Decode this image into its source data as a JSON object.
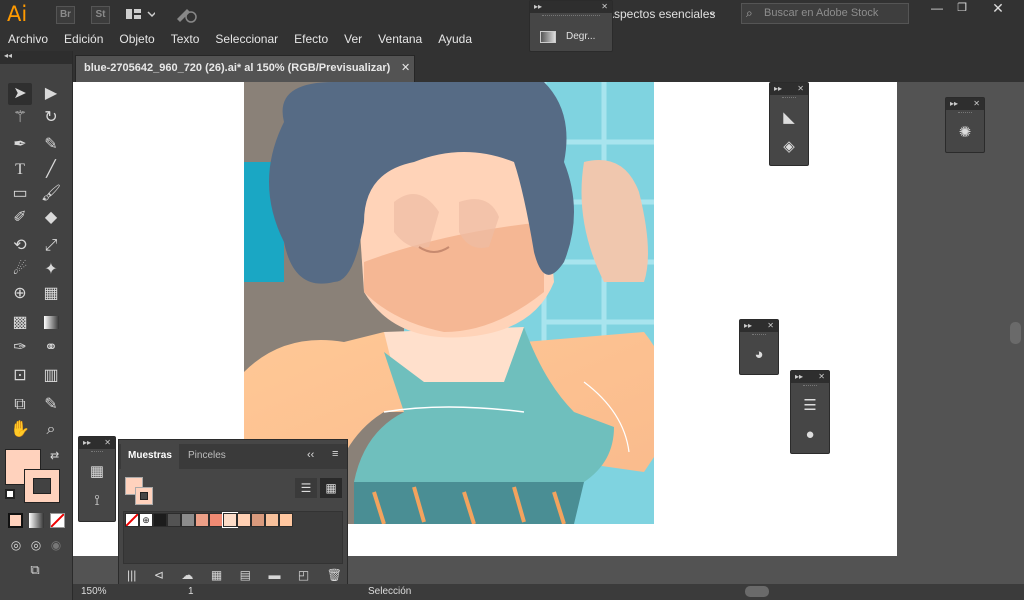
{
  "app": {
    "logo": "Ai",
    "bridge": "Br",
    "stock": "St",
    "workspace": "Aspectos esenciales",
    "search_placeholder": "Buscar en Adobe Stock"
  },
  "menu": [
    "Archivo",
    "Edición",
    "Objeto",
    "Texto",
    "Seleccionar",
    "Efecto",
    "Ver",
    "Ventana",
    "Ayuda"
  ],
  "document": {
    "tab_title": "blue-2705642_960_720 (26).ai* al 150% (RGB/Previsualizar)",
    "close": "✕"
  },
  "floating_panel": {
    "item": "Degr..."
  },
  "swatches": {
    "tabs": [
      "Muestras",
      "Pinceles"
    ],
    "colors": [
      "#ffffff",
      "#1c1c1c",
      "#535353",
      "#8c8c8c",
      "#ec9f87",
      "#f08a73",
      "#fcdcc8",
      "#ffd0b3",
      "#d99a7d",
      "#f7c09b",
      "#ffc7a0"
    ]
  },
  "status": {
    "zoom": "150%",
    "page": "1",
    "mode": "Selección"
  },
  "colors": {
    "fill": "#ffd2bd",
    "hair": "#566b85",
    "skin": "#ffd3b8",
    "shoulder": "#ffc397",
    "top": "#6fbfbd",
    "pool": "#7fd3e0"
  }
}
